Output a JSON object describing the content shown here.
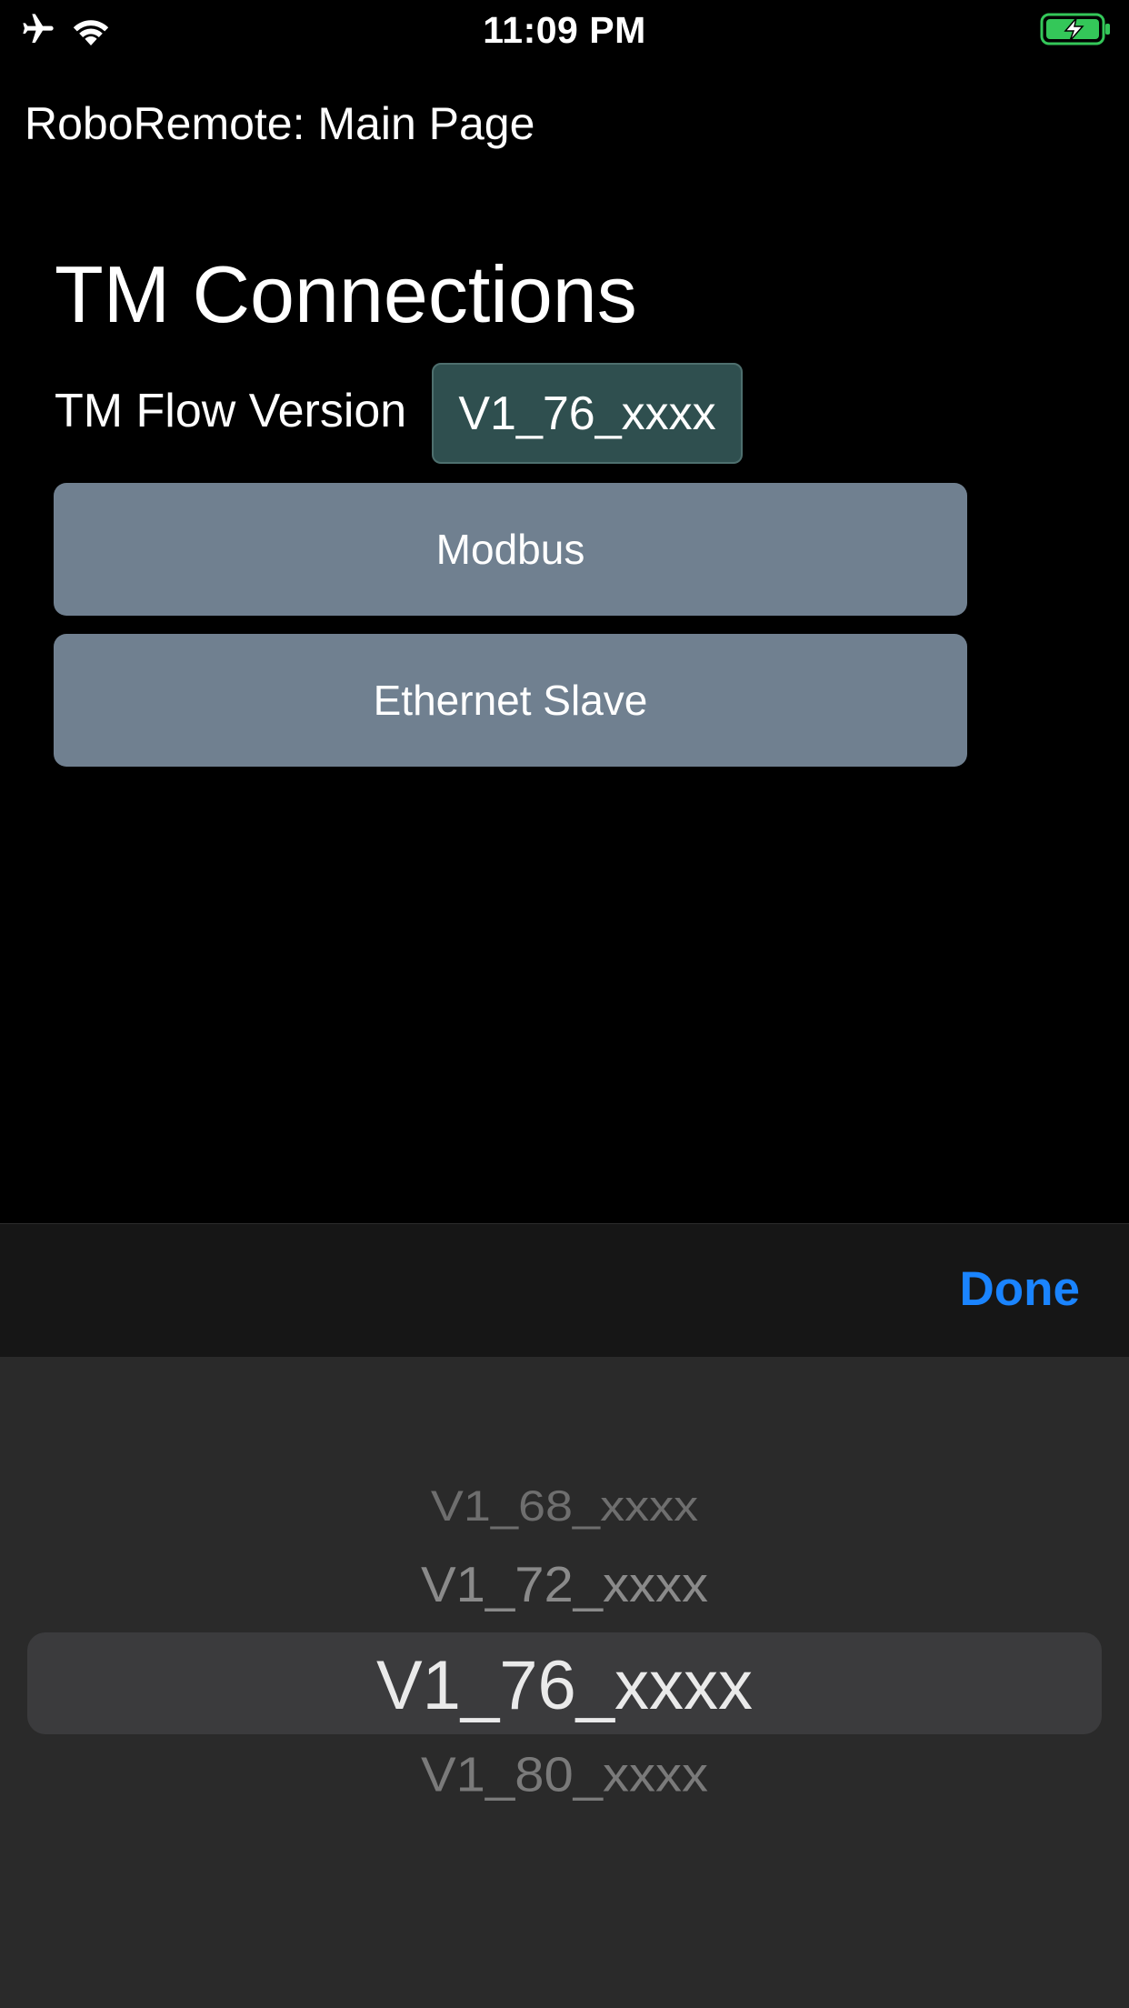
{
  "status_bar": {
    "time": "11:09 PM",
    "icons": [
      "airplane-icon",
      "wifi-icon",
      "battery-charging-icon"
    ],
    "battery_color": "#34c759"
  },
  "nav": {
    "title": "RoboRemote: Main Page"
  },
  "main": {
    "heading": "TM Connections",
    "version_label": "TM Flow Version",
    "version_value": "V1_76_xxxx",
    "buttons": [
      {
        "label": "Modbus"
      },
      {
        "label": "Ethernet Slave"
      }
    ]
  },
  "toolbar": {
    "done_label": "Done",
    "done_color": "#1a84ff"
  },
  "picker": {
    "options": [
      "V1_68_xxxx",
      "V1_72_xxxx",
      "V1_76_xxxx",
      "V1_80_xxxx"
    ],
    "selected": "V1_76_xxxx"
  },
  "colors": {
    "background": "#000000",
    "button_bg": "#708090",
    "field_bg": "#2f4f4f"
  }
}
